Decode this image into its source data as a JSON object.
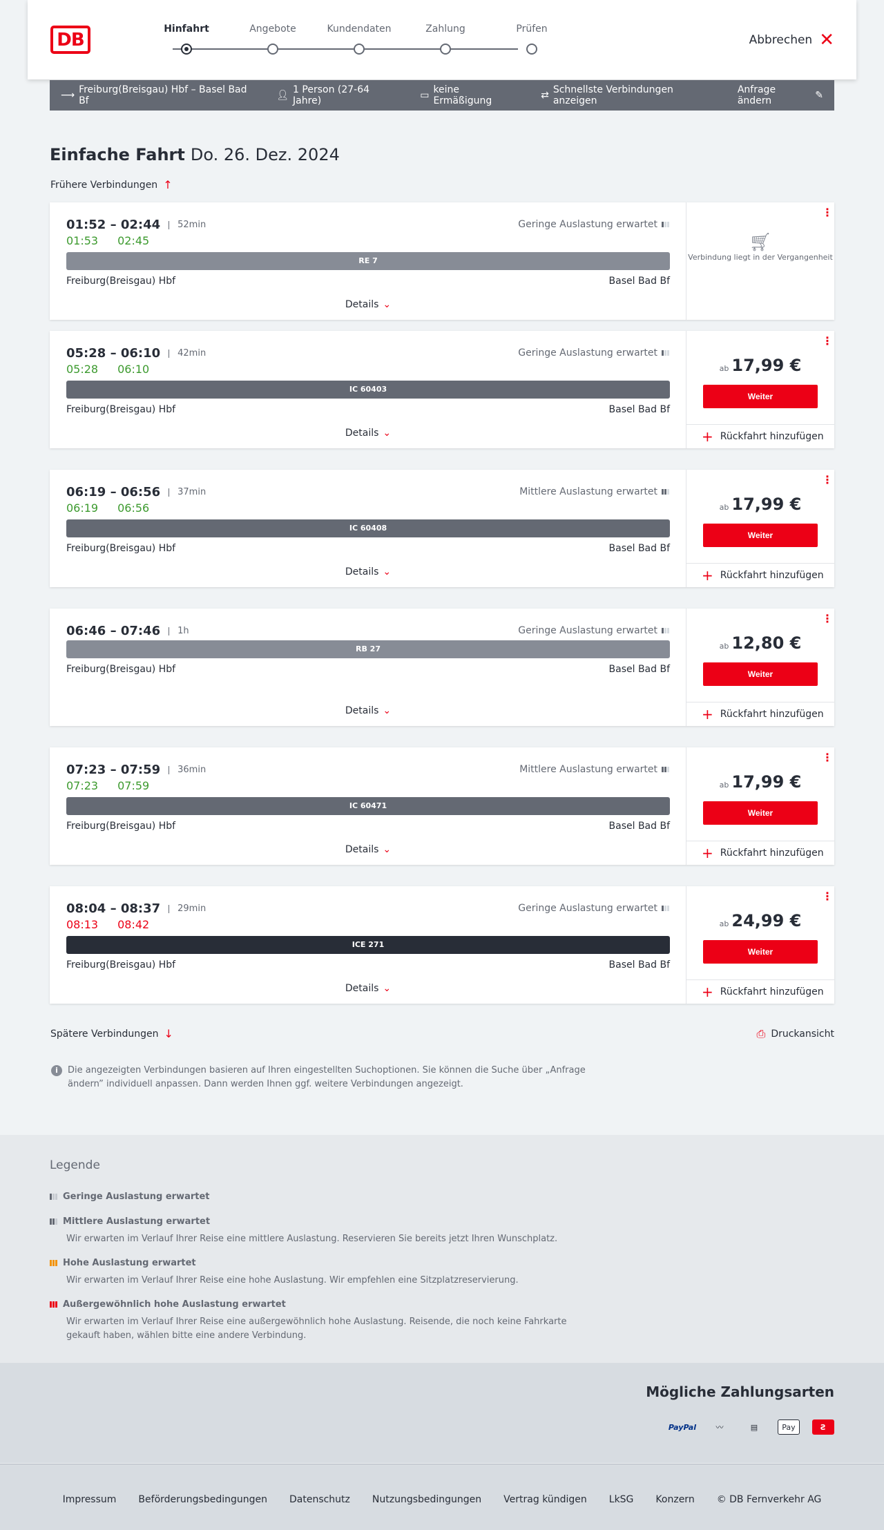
{
  "header": {
    "logo": "DB",
    "steps": [
      "Hinfahrt",
      "Angebote",
      "Kundendaten",
      "Zahlung",
      "Prüfen"
    ],
    "active_step": 0,
    "cancel_label": "Abbrechen"
  },
  "query": {
    "route": "Freiburg(Breisgau) Hbf – Basel Bad Bf",
    "persons": "1 Person (27-64 Jahre)",
    "discount": "keine Ermäßigung",
    "fastest": "Schnellste Verbindungen anzeigen",
    "change": "Anfrage ändern"
  },
  "page": {
    "title": "Einfache Fahrt",
    "date": "Do. 26. Dez. 2024",
    "earlier": "Frühere Verbindungen",
    "later": "Spätere Verbindungen",
    "print": "Druckansicht",
    "info": "Die angezeigten Verbindungen basieren auf Ihren eingestellten Suchoptionen. Sie können die Suche über „Anfrage ändern” individuell anpassen. Dann werden Ihnen ggf. weitere Verbindungen angezeigt.",
    "details_label": "Details",
    "weiter_label": "Weiter",
    "return_label": "Rückfahrt hinzufügen",
    "price_prefix": "ab",
    "past_text": "Verbindung liegt in der Vergangenheit"
  },
  "connections": [
    {
      "times": "01:52 – 02:44",
      "duration": "52min",
      "rt_dep": "01:53",
      "rt_arr": "02:45",
      "late": false,
      "load": "Geringe Auslastung erwartet",
      "load_level": 1,
      "train": "RE 7",
      "type": "re",
      "from": "Freiburg(Breisgau) Hbf",
      "to": "Basel Bad Bf",
      "price": "",
      "past": true
    },
    {
      "times": "05:28 – 06:10",
      "duration": "42min",
      "rt_dep": "05:28",
      "rt_arr": "06:10",
      "late": false,
      "load": "Geringe Auslastung erwartet",
      "load_level": 1,
      "train": "IC 60403",
      "type": "ic",
      "from": "Freiburg(Breisgau) Hbf",
      "to": "Basel Bad Bf",
      "price": "17,99 €",
      "past": false
    },
    {
      "times": "06:19 – 06:56",
      "duration": "37min",
      "rt_dep": "06:19",
      "rt_arr": "06:56",
      "late": false,
      "load": "Mittlere Auslastung erwartet",
      "load_level": 2,
      "train": "IC 60408",
      "type": "ic",
      "from": "Freiburg(Breisgau) Hbf",
      "to": "Basel Bad Bf",
      "price": "17,99 €",
      "past": false
    },
    {
      "times": "06:46 – 07:46",
      "duration": "1h",
      "rt_dep": "",
      "rt_arr": "",
      "late": false,
      "load": "Geringe Auslastung erwartet",
      "load_level": 1,
      "train": "RB 27",
      "type": "re",
      "from": "Freiburg(Breisgau) Hbf",
      "to": "Basel Bad Bf",
      "price": "12,80 €",
      "past": false
    },
    {
      "times": "07:23 – 07:59",
      "duration": "36min",
      "rt_dep": "07:23",
      "rt_arr": "07:59",
      "late": false,
      "load": "Mittlere Auslastung erwartet",
      "load_level": 2,
      "train": "IC 60471",
      "type": "ic",
      "from": "Freiburg(Breisgau) Hbf",
      "to": "Basel Bad Bf",
      "price": "17,99 €",
      "past": false
    },
    {
      "times": "08:04 – 08:37",
      "duration": "29min",
      "rt_dep": "08:13",
      "rt_arr": "08:42",
      "late": true,
      "load": "Geringe Auslastung erwartet",
      "load_level": 1,
      "train": "ICE 271",
      "type": "ice",
      "from": "Freiburg(Breisgau) Hbf",
      "to": "Basel Bad Bf",
      "price": "24,99 €",
      "past": false
    }
  ],
  "legend": {
    "title": "Legende",
    "items": [
      {
        "title": "Geringe Auslastung erwartet",
        "desc": "",
        "level": "low"
      },
      {
        "title": "Mittlere Auslastung erwartet",
        "desc": "Wir erwarten im Verlauf Ihrer Reise eine mittlere Auslastung. Reservieren Sie bereits jetzt Ihren Wunschplatz.",
        "level": "mid"
      },
      {
        "title": "Hohe Auslastung erwartet",
        "desc": "Wir erwarten im Verlauf Ihrer Reise eine hohe Auslastung. Wir empfehlen eine Sitzplatzreservierung.",
        "level": "high"
      },
      {
        "title": "Außergewöhnlich hohe Auslastung erwartet",
        "desc": "Wir erwarten im Verlauf Ihrer Reise eine außergewöhnlich hohe Auslastung. Reisende, die noch keine Fahrkarte gekauft haben, wählen bitte eine andere Verbindung.",
        "level": "ext"
      }
    ]
  },
  "payments": {
    "title": "Mögliche Zahlungsarten",
    "methods": [
      "PayPal",
      "Pay"
    ],
    "paypal": "PayPal",
    "applepay": "Pay"
  },
  "footer": {
    "links": [
      "Impressum",
      "Beförderungsbedingungen",
      "Datenschutz",
      "Nutzungsbedingungen",
      "Vertrag kündigen",
      "LkSG",
      "Konzern",
      "© DB Fernverkehr AG"
    ]
  },
  "colors": {
    "brand": "#ec0016",
    "ontime": "#3c9a2e"
  }
}
